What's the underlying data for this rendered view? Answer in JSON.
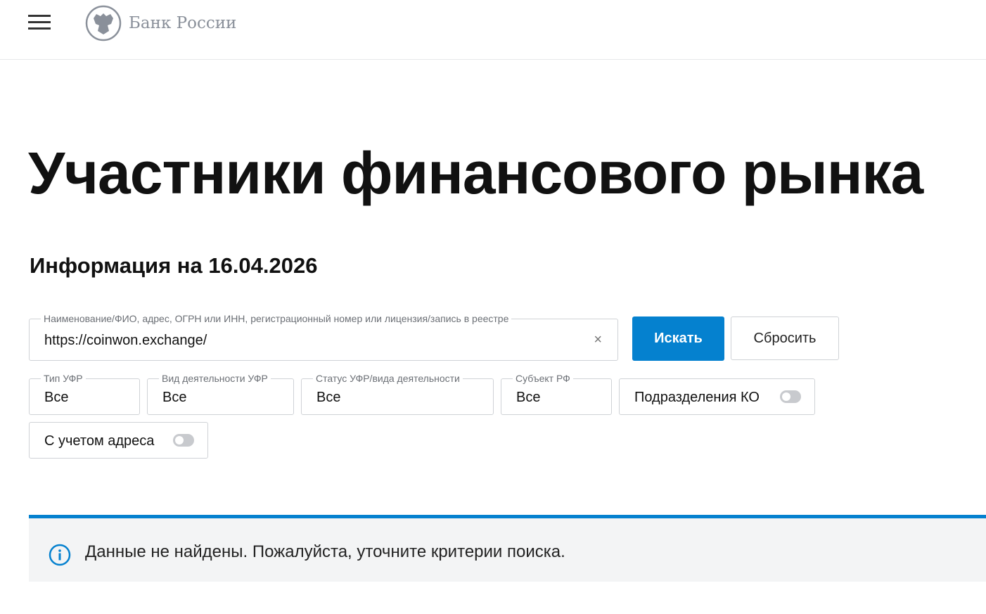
{
  "header": {
    "logo_text": "Банк России"
  },
  "page": {
    "title": "Участники финансового рынка",
    "info_date": "Информация на 16.04.2026"
  },
  "search": {
    "label": "Наименование/ФИО, адрес, ОГРН или ИНН, регистрационный номер или лицензия/запись в реестре",
    "value": "https://coinwon.exchange/",
    "clear": "×",
    "search_button": "Искать",
    "reset_button": "Сбросить"
  },
  "filters": [
    {
      "label": "Тип УФР",
      "value": "Все"
    },
    {
      "label": "Вид деятельности УФР",
      "value": "Все"
    },
    {
      "label": "Статус УФР/вида деятельности",
      "value": "Все"
    },
    {
      "label": "Субъект РФ",
      "value": "Все"
    }
  ],
  "toggles": {
    "branches": "Подразделения КО",
    "address": "С учетом адреса"
  },
  "notice": {
    "text": "Данные не найдены. Пожалуйста, уточните критерии поиска."
  },
  "colors": {
    "accent": "#0581cf"
  }
}
